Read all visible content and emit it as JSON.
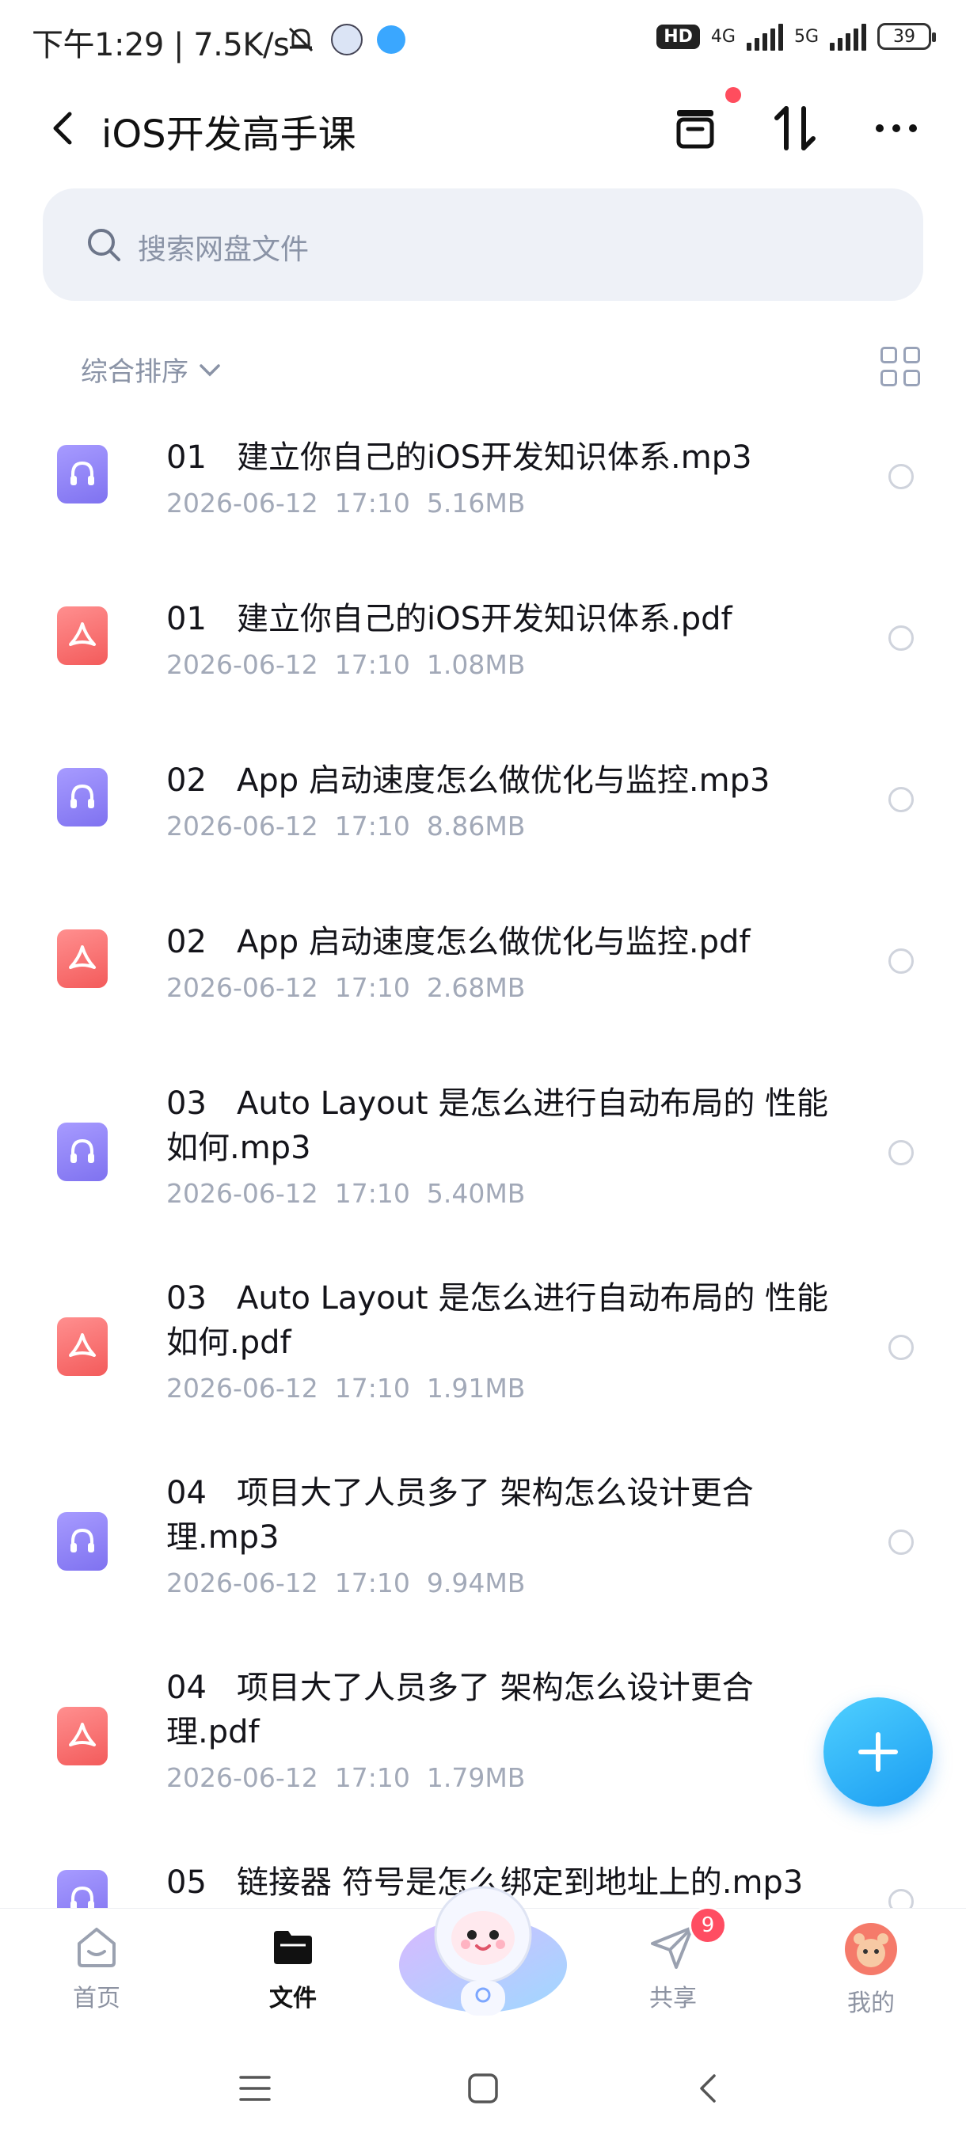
{
  "status_bar": {
    "time": "下午1:29",
    "speed": "7.5K/s",
    "network_1": "4G",
    "network_2": "5G",
    "hd": "HD",
    "battery": "39"
  },
  "header": {
    "title": "iOS开发高手课"
  },
  "search": {
    "placeholder": "搜索网盘文件"
  },
  "sort": {
    "label": "综合排序"
  },
  "files": [
    {
      "type": "audio",
      "name": "01   建立你自己的iOS开发知识体系.mp3",
      "date": "2026-06-12  17:10",
      "size": "5.16MB"
    },
    {
      "type": "pdf",
      "name": "01   建立你自己的iOS开发知识体系.pdf",
      "date": "2026-06-12  17:10",
      "size": "1.08MB"
    },
    {
      "type": "audio",
      "name": "02   App 启动速度怎么做优化与监控.mp3",
      "date": "2026-06-12  17:10",
      "size": "8.86MB"
    },
    {
      "type": "pdf",
      "name": "02   App 启动速度怎么做优化与监控.pdf",
      "date": "2026-06-12  17:10",
      "size": "2.68MB"
    },
    {
      "type": "audio",
      "name": "03   Auto Layout 是怎么进行自动布局的 性能如何.mp3",
      "date": "2026-06-12  17:10",
      "size": "5.40MB"
    },
    {
      "type": "pdf",
      "name": "03   Auto Layout 是怎么进行自动布局的 性能如何.pdf",
      "date": "2026-06-12  17:10",
      "size": "1.91MB"
    },
    {
      "type": "audio",
      "name": "04   项目大了人员多了 架构怎么设计更合理.mp3",
      "date": "2026-06-12  17:10",
      "size": "9.94MB"
    },
    {
      "type": "pdf",
      "name": "04   项目大了人员多了 架构怎么设计更合理.pdf",
      "date": "2026-06-12  17:10",
      "size": "1.79MB"
    },
    {
      "type": "audio",
      "name": "05   链接器 符号是怎么绑定到地址上的.mp3",
      "date": "",
      "size": ""
    }
  ],
  "bottom_nav": {
    "home": "首页",
    "files": "文件",
    "share": "共享",
    "share_badge": "9",
    "me": "我的"
  },
  "colors": {
    "accent": "#1a9cf2",
    "audio_icon": "#8b7ff5",
    "pdf_icon": "#f46464",
    "badge": "#ff4d62"
  }
}
